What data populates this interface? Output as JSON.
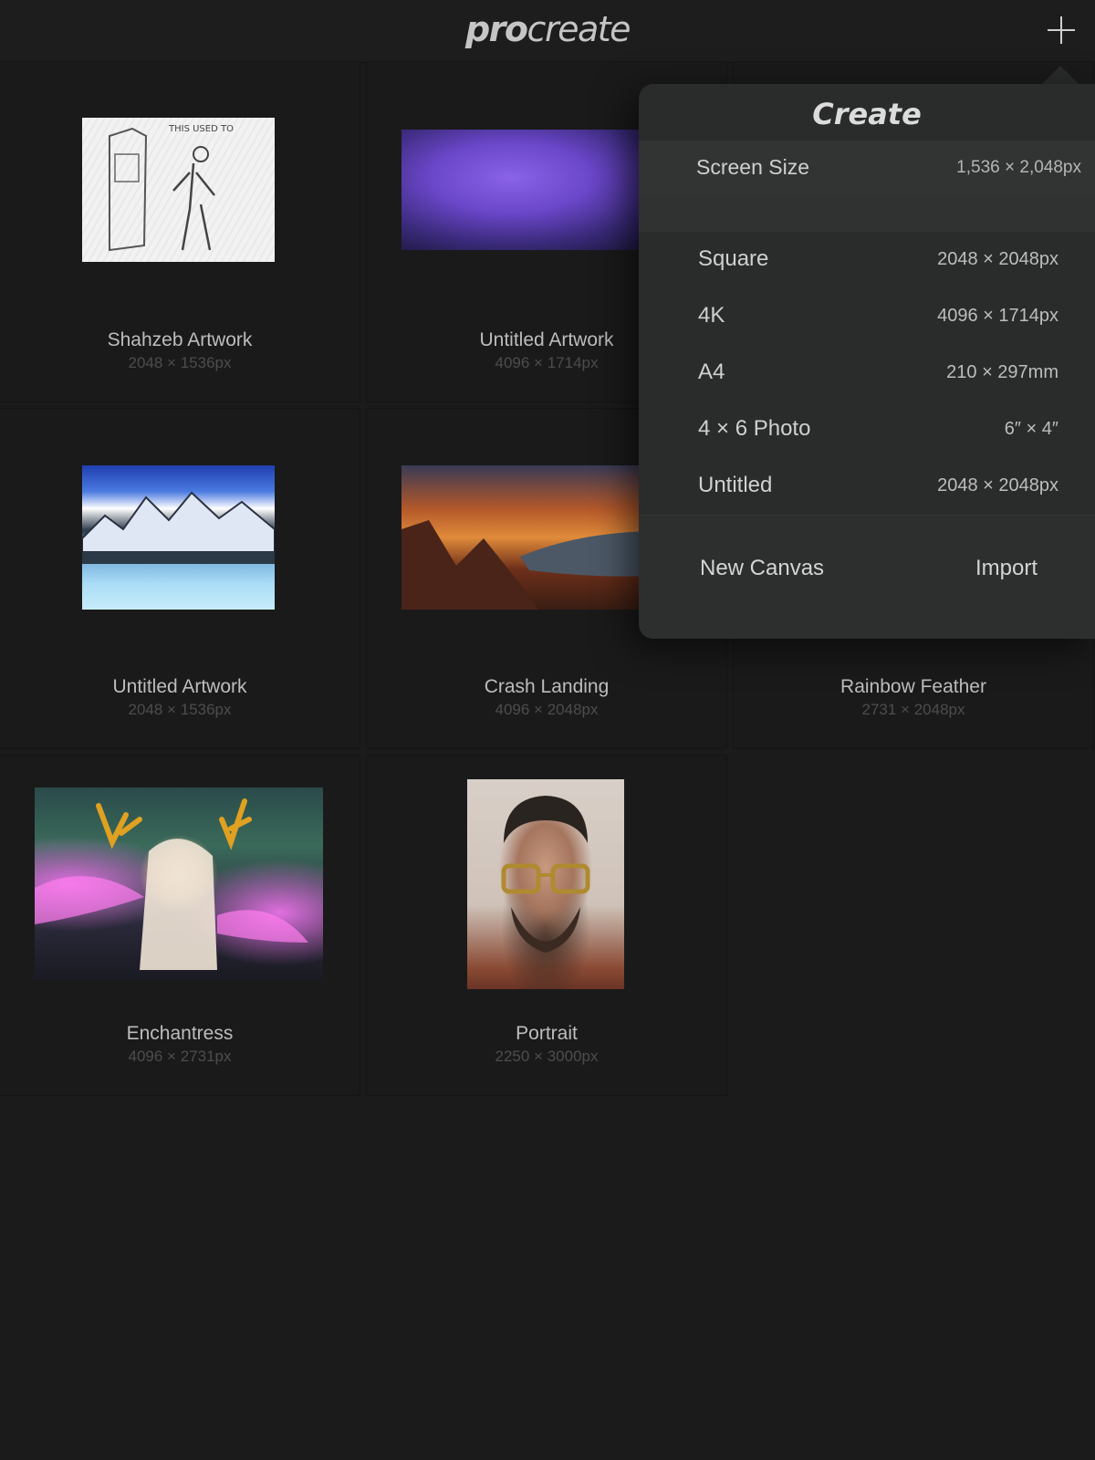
{
  "app": {
    "logo_bold": "pro",
    "logo_light": "create",
    "add_icon": "plus-icon"
  },
  "gallery": [
    {
      "title": "Shahzeb Artwork",
      "size": "2048 × 1536px"
    },
    {
      "title": "Untitled Artwork",
      "size": "4096 × 1714px"
    },
    {
      "title": "Untitled Artwork",
      "size": "2048 × 1536px"
    },
    {
      "title": "Crash Landing",
      "size": "4096 × 2048px"
    },
    {
      "title": "Rainbow Feather",
      "size": "2731 × 2048px"
    },
    {
      "title": "Enchantress",
      "size": "4096 × 2731px"
    },
    {
      "title": "Portrait",
      "size": "2250 × 3000px"
    }
  ],
  "create_menu": {
    "title": "Create",
    "screen_size": {
      "label": "Screen Size",
      "value": "1,536 × 2,048px"
    },
    "presets": [
      {
        "label": "Square",
        "value": "2048 × 2048px"
      },
      {
        "label": "4K",
        "value": "4096 × 1714px"
      },
      {
        "label": "A4",
        "value": "210 × 297mm"
      },
      {
        "label": "4 × 6 Photo",
        "value": "6″ × 4″"
      },
      {
        "label": "Untitled",
        "value": "2048 × 2048px"
      }
    ],
    "new_canvas": "New Canvas",
    "import": "Import"
  },
  "colors": {
    "background": "#1b1b1c",
    "popover": "#2a2b2b",
    "text": "#bdbdbd",
    "subtext": "#4d4d4f"
  }
}
